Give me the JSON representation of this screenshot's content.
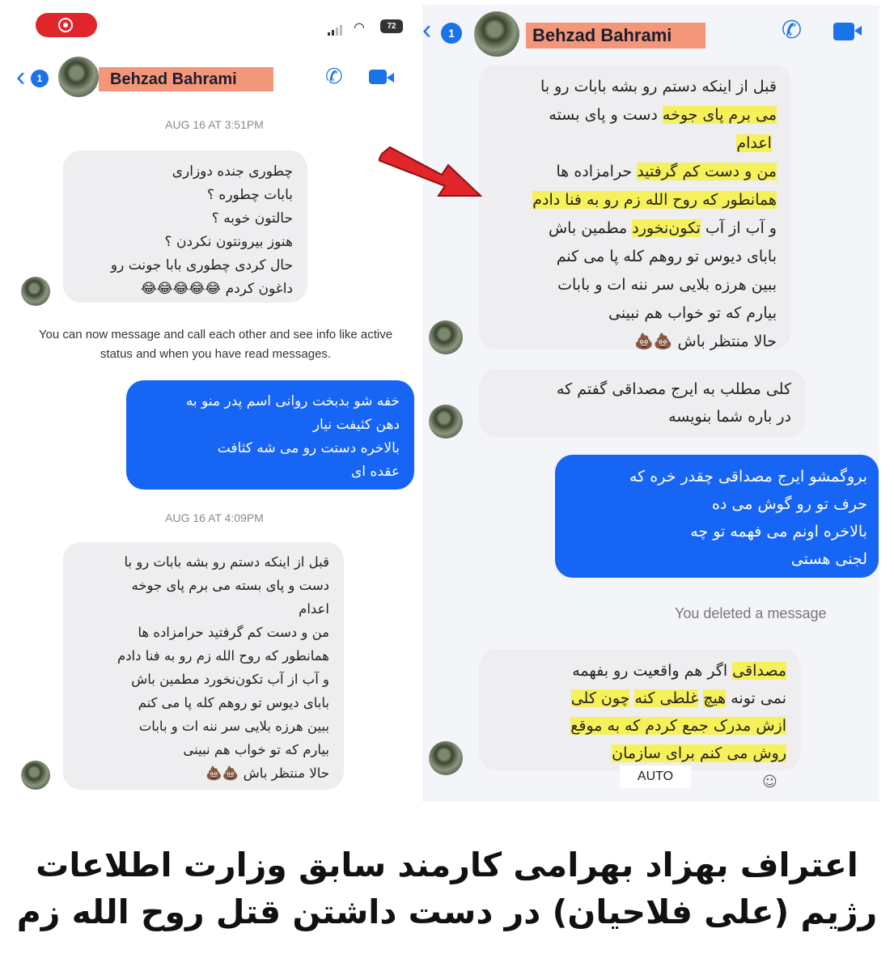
{
  "left": {
    "status": {
      "battery": "72"
    },
    "header": {
      "back_count": "1",
      "name": "Behzad Bahrami"
    },
    "timestamp1": "AUG 16 AT 3:51PM",
    "msg1": "چطوری جنده دوزاری\nبابات چطوره ؟\nحالتون خوبه ؟\nهنوز بیرونتون نکردن ؟\nحال کردی چطوری بابا جونت رو\nداغون کردم 😂😂😂😂😂",
    "system_note": "You can now message and call each other and see info\nlike active status and when you have read messages.",
    "msg2": "خفه شو بدبخت روانی  اسم پدر منو به\nدهن کثیفت نیار\nبالاخره دستت رو می شه کثافت\nعقده ای",
    "timestamp2": "AUG 16 AT 4:09PM",
    "msg3": "قبل از اینکه دستم رو بشه بابات رو با\nدست و پای بسته می برم پای جوخه\n اعدام\nمن و دست کم گرفتید حرامزاده ها\nهمانطور که روح الله زم رو به فنا دادم\nو آب از آب تکون‌نخورد  مطمین باش\nبابای  دیوس تو روهم  کله پا می کنم\nببین  هرزه بلایی سر ننه ات و بابات\nبیارم که تو خواب هم نبینی\nحالا منتظر باش 💩💩"
  },
  "right": {
    "header": {
      "back_count": "1",
      "name": "Behzad Bahrami"
    },
    "msg1": {
      "l1": "قبل از اینکه دستم رو بشه بابات رو با",
      "l2a": "دست و پای بسته",
      "l2b": "می برم پای جوخه",
      "l3": "اعدام",
      "l4a": "من و دست کم گرفتید",
      "l4b": "حرامزاده ها",
      "l5": "همانطور که روح الله زم رو به فنا دادم",
      "l6a": "و آب از آب",
      "l6b": "تکون‌نخورد",
      "l6c": "مطمین باش",
      "l7": "بابای  دیوس تو روهم  کله پا می کنم",
      "l8": "ببین  هرزه بلایی سر ننه ات و بابات",
      "l9": "بیارم که تو خواب هم نبینی",
      "l10": "حالا منتظر باش 💩💩"
    },
    "msg2": "کلی مطلب به ایرج مصداقی  گفتم که\nدر باره شما بنویسه",
    "msg3": "بروگمشو  ایرج مصداقی چقدر خره که\nحرف تو رو گوش می ده\nبالاخره اونم می فهمه تو چه\nلجنی هستی",
    "deleted": "You deleted a message",
    "msg4": {
      "l1a": "مصداقی",
      "l1b": "اگر هم  واقعیت رو بفهمه",
      "l2a": "نمی تونه",
      "l2b": "هیچ",
      "l2c": "غلطی کنه",
      "l2d": "چون کلی",
      "l3": "ازش مدرک جمع کردم که به موقع",
      "l4": "روش می کنم برای سازمان"
    },
    "auto_label": "AUTO"
  },
  "caption": "اعتراف بهزاد بهرامی کارمند سابق وزارت اطلاعات\nرژیم (علی فلاحیان) در دست داشتن قتل روح الله زم",
  "colors": {
    "accent": "#1a73e8",
    "bubble_blue": "#1665f5",
    "highlight": "#f6f05a",
    "name_tag": "#f4967a",
    "arrow": "#e0262b"
  }
}
